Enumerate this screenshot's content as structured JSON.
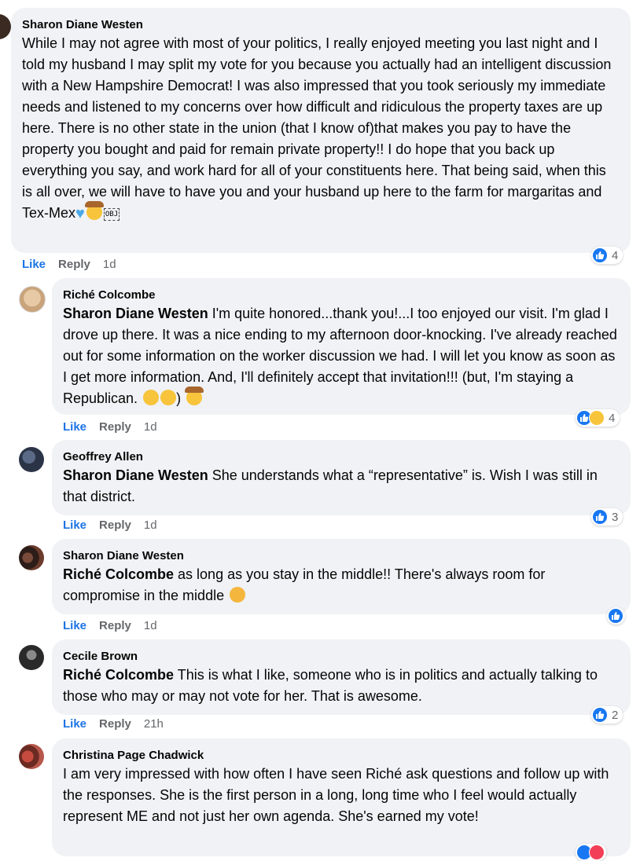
{
  "comments": [
    {
      "author": "Sharon Diane Westen",
      "text": "While I may not agree with most of your politics, I really enjoyed meeting you last night and I told my husband I may split my vote for you because you actually had an intelligent discussion with a New Hampshire Democrat! I was also impressed that you took seriously my immediate needs and listened to my concerns over how difficult and ridiculous the property taxes are up here. There is no other state in the union (that I know of)that makes you pay to have the property you bought and paid for remain private property!! I do hope that you back up everything you say, and work hard for all of your constituents here. That being said, when this is all over, we will have to have you and your husband up here to the farm for margaritas and Tex-Mex",
      "obj_glyph": "OBJ",
      "like": "Like",
      "reply": "Reply",
      "time": "1d",
      "reactions": "4"
    },
    {
      "author": "Riché Colcombe",
      "mention": "Sharon Diane Westen",
      "text": " I'm quite honored...thank you!...I too enjoyed our visit. I'm glad I drove up there. It was a nice ending to my afternoon door-knocking. I've already reached out for some information on the worker discussion we had. I will let you know as soon as I get more information. And, I'll definitely accept that invitation!!! (but, I'm staying a Republican.",
      "text_end": ")",
      "like": "Like",
      "reply": "Reply",
      "time": "1d",
      "reactions": "4"
    },
    {
      "author": "Geoffrey Allen",
      "mention": "Sharon Diane Westen",
      "text": " She understands what a “representative” is. Wish I was still in that district.",
      "like": "Like",
      "reply": "Reply",
      "time": "1d",
      "reactions": "3"
    },
    {
      "author": "Sharon Diane Westen",
      "mention": "Riché Colcombe",
      "text": " as long as you stay in the middle!! There's always room for compromise in the middle",
      "like": "Like",
      "reply": "Reply",
      "time": "1d"
    },
    {
      "author": "Cecile Brown",
      "mention": "Riché Colcombe",
      "text": " This is what I like, someone who is in politics and actually talking to those who may or may not vote for her. That is awesome.",
      "like": "Like",
      "reply": "Reply",
      "time": "21h",
      "reactions": "2"
    },
    {
      "author": "Christina Page Chadwick",
      "text": "I am very impressed with how often I have seen Riché ask questions and follow up with the responses. She is the first person in a long, long time who I feel would actually represent ME and not just her own agenda. She's earned my vote!"
    }
  ],
  "colors": {
    "bubble": "#f0f2f5",
    "like_blue": "#1b74e4",
    "meta_gray": "#65676b"
  }
}
